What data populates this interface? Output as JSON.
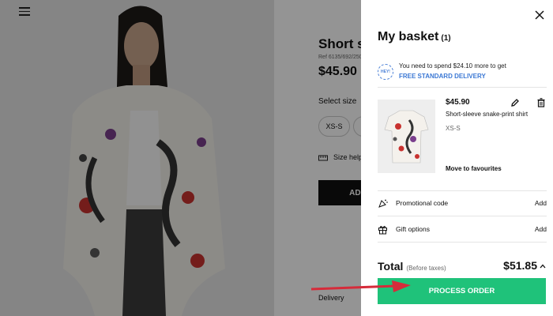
{
  "product_page": {
    "title": "Short sl",
    "ref": "Ref 6135/692/250",
    "price": "$45.90",
    "select_size": "Select size",
    "size_option": "XS-S",
    "size_help": "Size help",
    "add_label": "ADD",
    "delivery": "Delivery"
  },
  "basket": {
    "title": "My basket",
    "count": "(1)",
    "spend_message": "You need to spend $24.10 more to get",
    "free_delivery": "FREE STANDARD DELIVERY",
    "badge": "HEY!",
    "item": {
      "price": "$45.90",
      "name": "Short-sleeve snake-print shirt",
      "size": "XS-S",
      "move_to_favourites": "Move to favourites"
    },
    "promotional_code": {
      "label": "Promotional code",
      "action": "Add"
    },
    "gift_options": {
      "label": "Gift options",
      "action": "Add"
    },
    "total": {
      "label": "Total",
      "tax_note": "(Before taxes)",
      "value": "$51.85"
    },
    "process_order": "PROCESS ORDER"
  },
  "colors": {
    "accent_green": "#1fc27a",
    "link_blue": "#3b78d4",
    "arrow_red": "#d62b3a"
  },
  "icons": [
    "menu-icon",
    "close-icon",
    "edit-icon",
    "trash-icon",
    "promo-tag-icon",
    "gift-icon",
    "chevron-up-icon",
    "ruler-icon"
  ]
}
